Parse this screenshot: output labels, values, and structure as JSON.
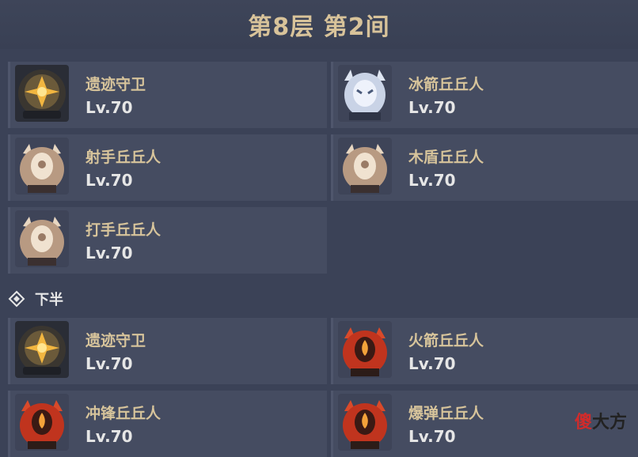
{
  "header": {
    "title": "第8层 第2间"
  },
  "first_half": [
    {
      "name": "遗迹守卫",
      "level": "Lv.70",
      "icon": "ruin-guard-icon"
    },
    {
      "name": "冰箭丘丘人",
      "level": "Lv.70",
      "icon": "cryo-hilichurl-shooter-icon"
    },
    {
      "name": "射手丘丘人",
      "level": "Lv.70",
      "icon": "hilichurl-shooter-icon"
    },
    {
      "name": "木盾丘丘人",
      "level": "Lv.70",
      "icon": "wooden-shieldwall-mitachurl-icon"
    },
    {
      "name": "打手丘丘人",
      "level": "Lv.70",
      "icon": "hilichurl-fighter-icon"
    }
  ],
  "second_half_label": "下半",
  "second_half": [
    {
      "name": "遗迹守卫",
      "level": "Lv.70",
      "icon": "ruin-guard-icon"
    },
    {
      "name": "火箭丘丘人",
      "level": "Lv.70",
      "icon": "pyro-hilichurl-shooter-icon"
    },
    {
      "name": "冲锋丘丘人",
      "level": "Lv.70",
      "icon": "hilichurl-berserker-icon"
    },
    {
      "name": "爆弹丘丘人",
      "level": "Lv.70",
      "icon": "hilichurl-grenadier-icon"
    }
  ],
  "watermark": {
    "part1": "傻",
    "part2": "大方"
  },
  "colors": {
    "background": "#3b4257",
    "card": "#454c61",
    "title": "#d8c39a",
    "enemy_name": "#d7c49b"
  }
}
